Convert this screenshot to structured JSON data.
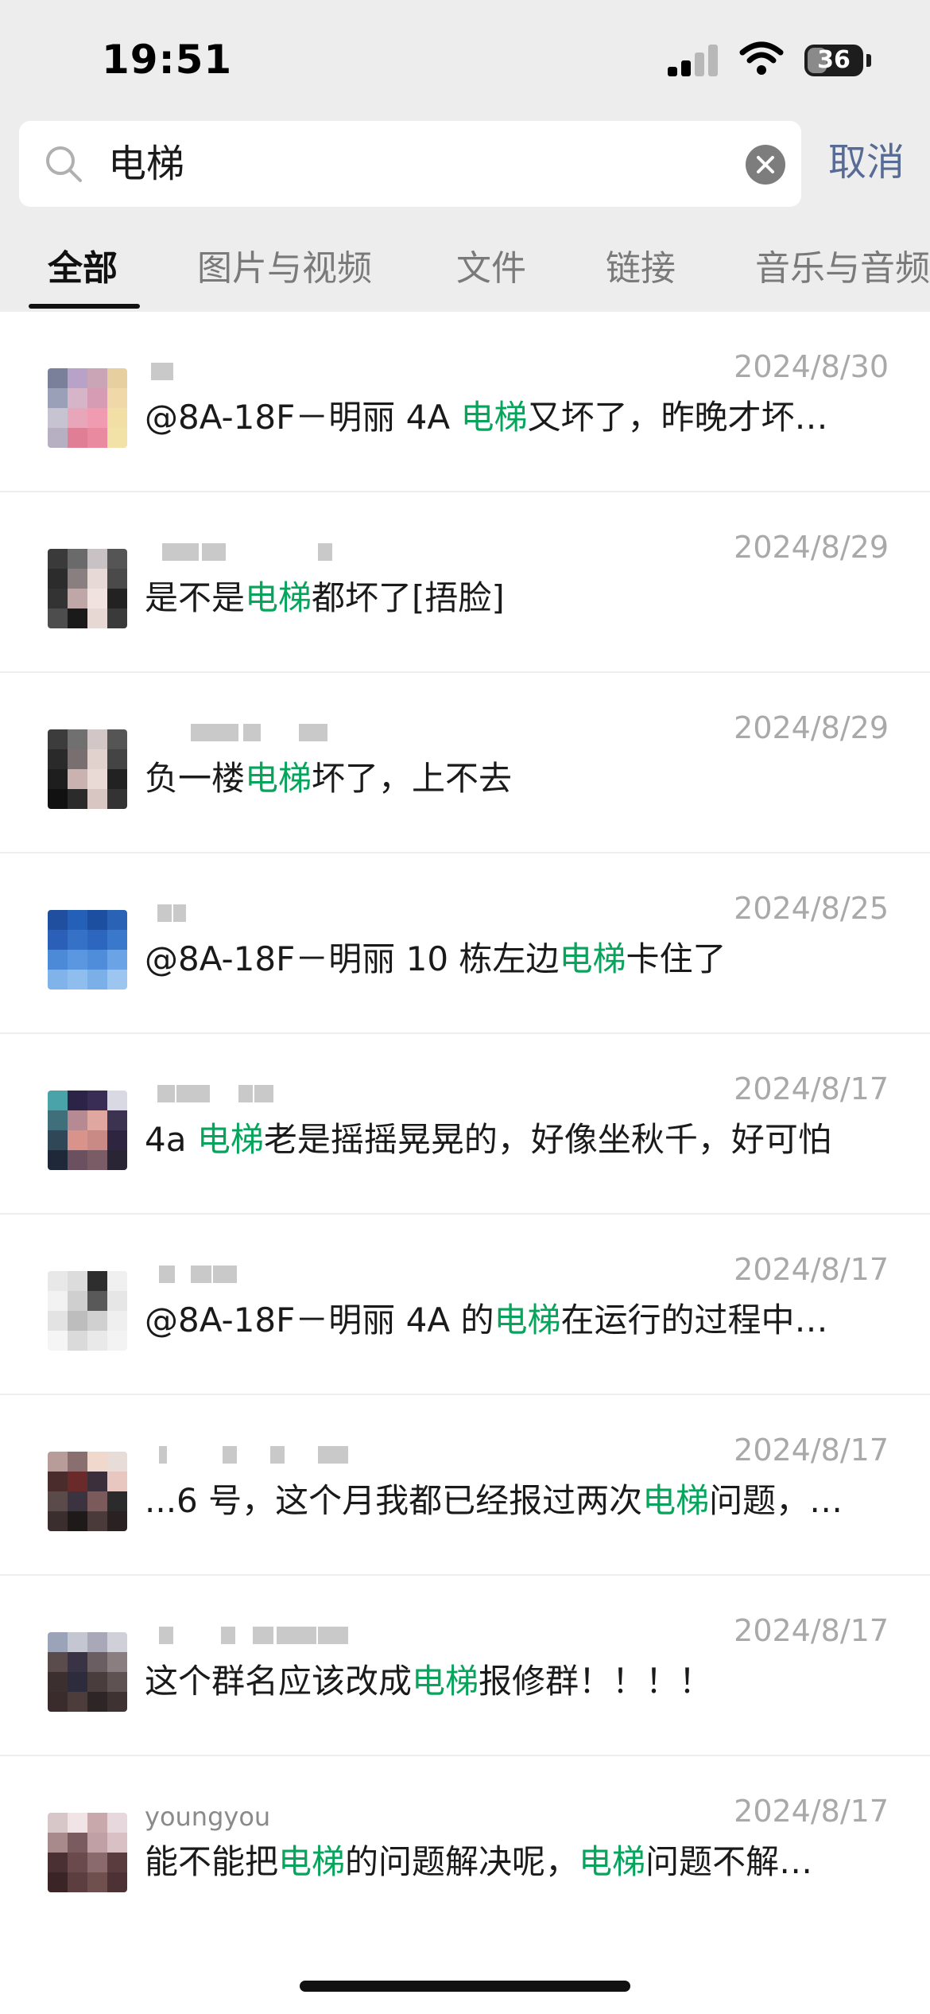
{
  "status_bar": {
    "time": "19:51",
    "battery": "36",
    "battery_fraction": 0.36
  },
  "search": {
    "query": "电梯",
    "cancel_label": "取消"
  },
  "tabs": [
    {
      "label": "全部",
      "active": true
    },
    {
      "label": "图片与视频",
      "active": false
    },
    {
      "label": "文件",
      "active": false
    },
    {
      "label": "链接",
      "active": false
    },
    {
      "label": "音乐与音频",
      "active": false
    }
  ],
  "highlight_color": "#07a55c",
  "results": [
    {
      "name": "",
      "date": "2024/8/30",
      "pre": "@8A-18F－明丽 4A ",
      "hl": "电梯",
      "post": "又坏了，昨晚才坏…",
      "hl2": "",
      "post2": ""
    },
    {
      "name": "",
      "date": "2024/8/29",
      "pre": "是不是",
      "hl": "电梯",
      "post": "都坏了[捂脸]",
      "hl2": "",
      "post2": ""
    },
    {
      "name": "",
      "date": "2024/8/29",
      "pre": "负一楼",
      "hl": "电梯",
      "post": "坏了，上不去",
      "hl2": "",
      "post2": ""
    },
    {
      "name": "",
      "date": "2024/8/25",
      "pre": "@8A-18F－明丽 10 栋左边",
      "hl": "电梯",
      "post": "卡住了",
      "hl2": "",
      "post2": ""
    },
    {
      "name": "",
      "date": "2024/8/17",
      "pre": "4a ",
      "hl": "电梯",
      "post": "老是摇摇晃晃的，好像坐秋千，好可怕",
      "hl2": "",
      "post2": ""
    },
    {
      "name": "",
      "date": "2024/8/17",
      "pre": "@8A-18F－明丽   4A 的",
      "hl": "电梯",
      "post": "在运行的过程中…",
      "hl2": "",
      "post2": ""
    },
    {
      "name": "",
      "date": "2024/8/17",
      "pre": "...6 号，这个月我都已经报过两次",
      "hl": "电梯",
      "post": "问题，…",
      "hl2": "",
      "post2": ""
    },
    {
      "name": "",
      "date": "2024/8/17",
      "pre": "这个群名应该改成",
      "hl": "电梯",
      "post": "报修群！！！！",
      "hl2": "",
      "post2": ""
    },
    {
      "name": "youngyou",
      "date": "2024/8/17",
      "pre": "能不能把",
      "hl": "电梯",
      "post": "的问题解决呢，",
      "hl2": "电梯",
      "post2": "问题不解…"
    }
  ]
}
